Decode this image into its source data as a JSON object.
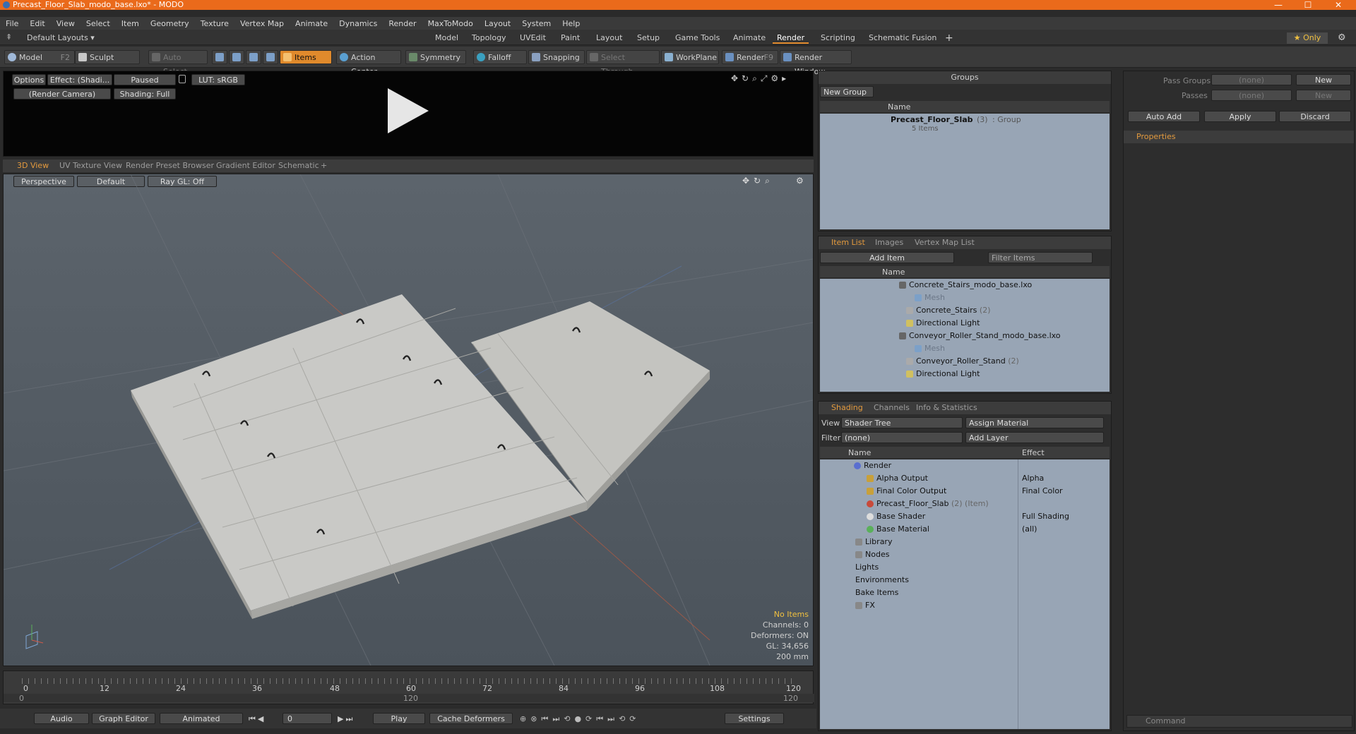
{
  "window": {
    "title": "Precast_Floor_Slab_modo_base.lxo* - MODO",
    "min": "—",
    "max": "☐",
    "close": "✕"
  },
  "menu": [
    "File",
    "Edit",
    "View",
    "Select",
    "Item",
    "Geometry",
    "Texture",
    "Vertex Map",
    "Animate",
    "Dynamics",
    "Render",
    "MaxToModo",
    "Layout",
    "System",
    "Help"
  ],
  "layoutbar": {
    "layouts_label": "Default Layouts ▾",
    "tabs": [
      "Model",
      "Topology",
      "UVEdit",
      "Paint",
      "Layout",
      "Setup",
      "Game Tools",
      "Animate",
      "Render",
      "Scripting",
      "Schematic Fusion"
    ],
    "active_tab": "Render",
    "plus": "+",
    "only_label": "★ Only",
    "gear": "⚙"
  },
  "toolbar": {
    "model": "Model",
    "model_key": "F2",
    "sculpt": "Sculpt",
    "auto_select": "Auto Select",
    "items": "Items",
    "action_center": "Action Center",
    "symmetry": "Symmetry",
    "falloff": "Falloff",
    "snapping": "Snapping",
    "select_through": "Select Through",
    "workplane": "WorkPlane",
    "render": "Render",
    "render_key": "F9",
    "render_window": "Render Window"
  },
  "preview": {
    "options": "Options",
    "effect": "Effect: (Shadi...",
    "paused": "Paused",
    "lut": "LUT: sRGB",
    "camera": "(Render Camera)",
    "shading": "Shading: Full"
  },
  "viewport_tabs": [
    "3D View",
    "UV Texture View",
    "Render Preset Browser",
    "Gradient Editor",
    "Schematic"
  ],
  "viewport": {
    "perspective": "Perspective",
    "default": "Default",
    "raygl": "Ray GL: Off",
    "status": {
      "items": "No Items",
      "channels": "Channels: 0",
      "deformers": "Deformers: ON",
      "gl": "GL: 34,656",
      "scale": "200 mm"
    }
  },
  "timeline": {
    "ticks": [
      "0",
      "12",
      "24",
      "36",
      "48",
      "60",
      "72",
      "84",
      "96",
      "108",
      "120"
    ],
    "sub_ticks": [
      "0",
      "120",
      "120"
    ]
  },
  "bottombar": {
    "audio": "Audio",
    "graph_editor": "Graph Editor",
    "animated": "Animated",
    "frame": "0",
    "play": "Play",
    "cache": "Cache Deformers",
    "settings": "Settings"
  },
  "groups": {
    "header": "Groups",
    "new_group": "New Group",
    "col_name": "Name",
    "item_name": "Precast_Floor_Slab",
    "item_count": "(3)",
    "item_type": ": Group",
    "item_sub": "5 Items"
  },
  "passes": {
    "pass_groups": "Pass Groups",
    "passes": "Passes",
    "none": "(none)",
    "new": "New",
    "auto_add": "Auto Add",
    "apply": "Apply",
    "discard": "Discard",
    "properties": "Properties"
  },
  "itemlist": {
    "tabs": [
      "Item List",
      "Images",
      "Vertex Map List"
    ],
    "add_item": "Add Item",
    "filter": "Filter Items",
    "col_name": "Name",
    "rows": [
      {
        "label": "Concrete_Stairs_modo_base.lxo",
        "indent": 0,
        "dim": false,
        "count": ""
      },
      {
        "label": "Mesh",
        "indent": 2,
        "dim": true,
        "count": ""
      },
      {
        "label": "Concrete_Stairs",
        "indent": 1,
        "dim": false,
        "count": "(2)"
      },
      {
        "label": "Directional Light",
        "indent": 1,
        "dim": false,
        "count": ""
      },
      {
        "label": "Conveyor_Roller_Stand_modo_base.lxo",
        "indent": 0,
        "dim": false,
        "count": ""
      },
      {
        "label": "Mesh",
        "indent": 2,
        "dim": true,
        "count": ""
      },
      {
        "label": "Conveyor_Roller_Stand",
        "indent": 1,
        "dim": false,
        "count": "(2)"
      },
      {
        "label": "Directional Light",
        "indent": 1,
        "dim": false,
        "count": ""
      }
    ]
  },
  "shading": {
    "tabs": [
      "Shading",
      "Channels",
      "Info & Statistics"
    ],
    "view_label": "View",
    "view_value": "Shader Tree",
    "assign": "Assign Material",
    "filter_label": "Filter",
    "filter_value": "(none)",
    "add_layer": "Add Layer",
    "col_name": "Name",
    "col_effect": "Effect",
    "rows": [
      {
        "label": "Render",
        "effect": "",
        "color": "#5a6fd0"
      },
      {
        "label": "Alpha Output",
        "effect": "Alpha",
        "color": "#c8a03a"
      },
      {
        "label": "Final Color Output",
        "effect": "Final Color",
        "color": "#c8a03a"
      },
      {
        "label": "Precast_Floor_Slab",
        "extra": "(2) (Item)",
        "effect": "",
        "color": "#c84a3a"
      },
      {
        "label": "Base Shader",
        "effect": "Full Shading",
        "color": "#cccccc"
      },
      {
        "label": "Base Material",
        "effect": "(all)",
        "color": "#5ab05a"
      },
      {
        "label": "Library",
        "effect": "",
        "color": ""
      },
      {
        "label": "Nodes",
        "effect": "",
        "color": ""
      },
      {
        "label": "Lights",
        "effect": "",
        "color": ""
      },
      {
        "label": "Environments",
        "effect": "",
        "color": ""
      },
      {
        "label": "Bake Items",
        "effect": "",
        "color": ""
      },
      {
        "label": "FX",
        "effect": "",
        "color": ""
      }
    ]
  },
  "command": {
    "placeholder": "Command"
  }
}
